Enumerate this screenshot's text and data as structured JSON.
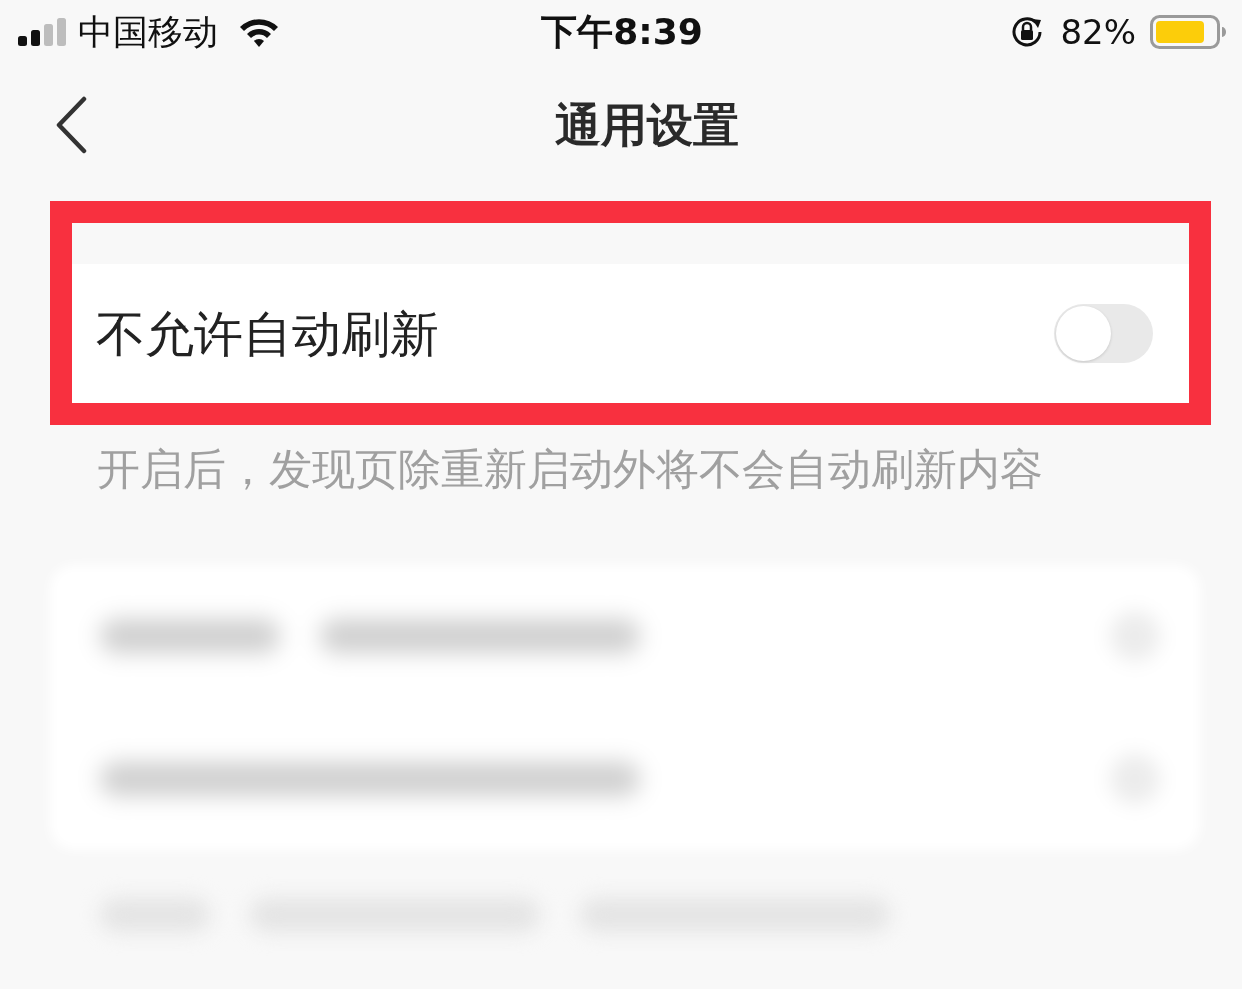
{
  "status_bar": {
    "carrier": "中国移动",
    "time": "下午8:39",
    "battery": "82%"
  },
  "nav_bar": {
    "title": "通用设置"
  },
  "settings": [
    {
      "kind": "toggle",
      "label": "不允许自动刷新",
      "on": false,
      "highlighted": true
    }
  ],
  "caption": "开启后，发现页除重新启动外将不会自动刷新内容",
  "obscured_rows": [
    {
      "kind": "card"
    },
    {
      "kind": "card"
    },
    {
      "kind": "loose"
    }
  ]
}
